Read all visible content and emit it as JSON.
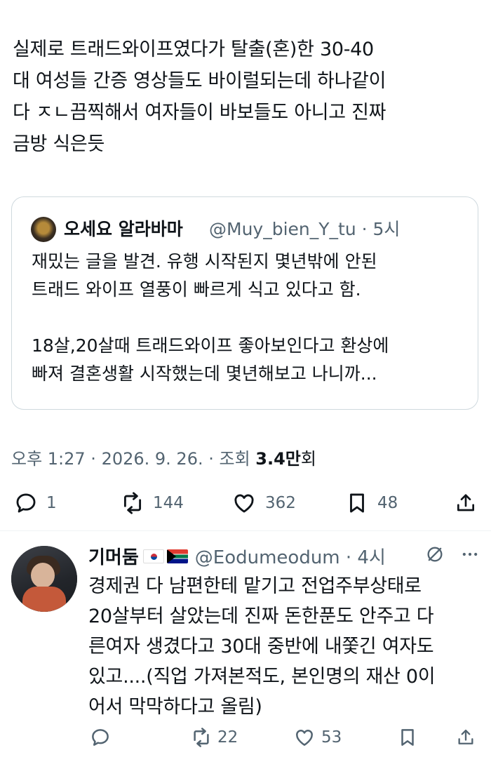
{
  "post": {
    "text_lines": [
      "실제로 트래드와이프였다가 탈출(혼)한 30-40",
      "대 여성들 간증 영상들도 바이럴되는데 하나같이",
      "다 ㅈㄴ끔찍해서 여자들이 바보들도 아니고 진짜",
      "금방 식은듯"
    ],
    "quote": {
      "name": "오세요 알라바마",
      "handle_time": "@Muy_bien_Y_tu · 5시",
      "body_lines": [
        "재밌는 글을 발견. 유행 시작된지 몇년밖에 안된",
        "트래드 와이프 열풍이 빠르게 식고 있다고 함.",
        "",
        "18살,20살때 트래드와이프 좋아보인다고 환상에",
        "빠져 결혼생활 시작했는데 몇년해보고 나니까..."
      ]
    },
    "meta": {
      "time": "오후 1:27 · 2026. 9. 26. · 조회 ",
      "views": "3.4만",
      "views_unit": "회"
    },
    "actions": {
      "replies": "1",
      "retweets": "144",
      "likes": "362",
      "bookmarks": "48"
    }
  },
  "reply": {
    "name": "기머둠",
    "handle_time": "@Eodumeodum · 4시",
    "body_lines": [
      "경제권 다 남편한테 맡기고 전업주부상태로",
      "20살부터 살았는데 진짜 돈한푼도 안주고 다",
      "른여자 생겼다고 30대 중반에 내쫓긴 여자도",
      "있고....(직업 가져본적도, 본인명의 재산 0이",
      "어서 막막하다고 올림)"
    ],
    "actions": {
      "retweets": "22",
      "likes": "53"
    }
  },
  "icons": {
    "reply": "reply-icon",
    "retweet": "retweet-icon",
    "like": "heart-icon",
    "bookmark": "bookmark-icon",
    "share": "share-icon",
    "grok": "grok-icon",
    "more": "more-icon"
  },
  "colors": {
    "text": "#0f1419",
    "secondary": "#536471",
    "border": "#cfd9de"
  }
}
